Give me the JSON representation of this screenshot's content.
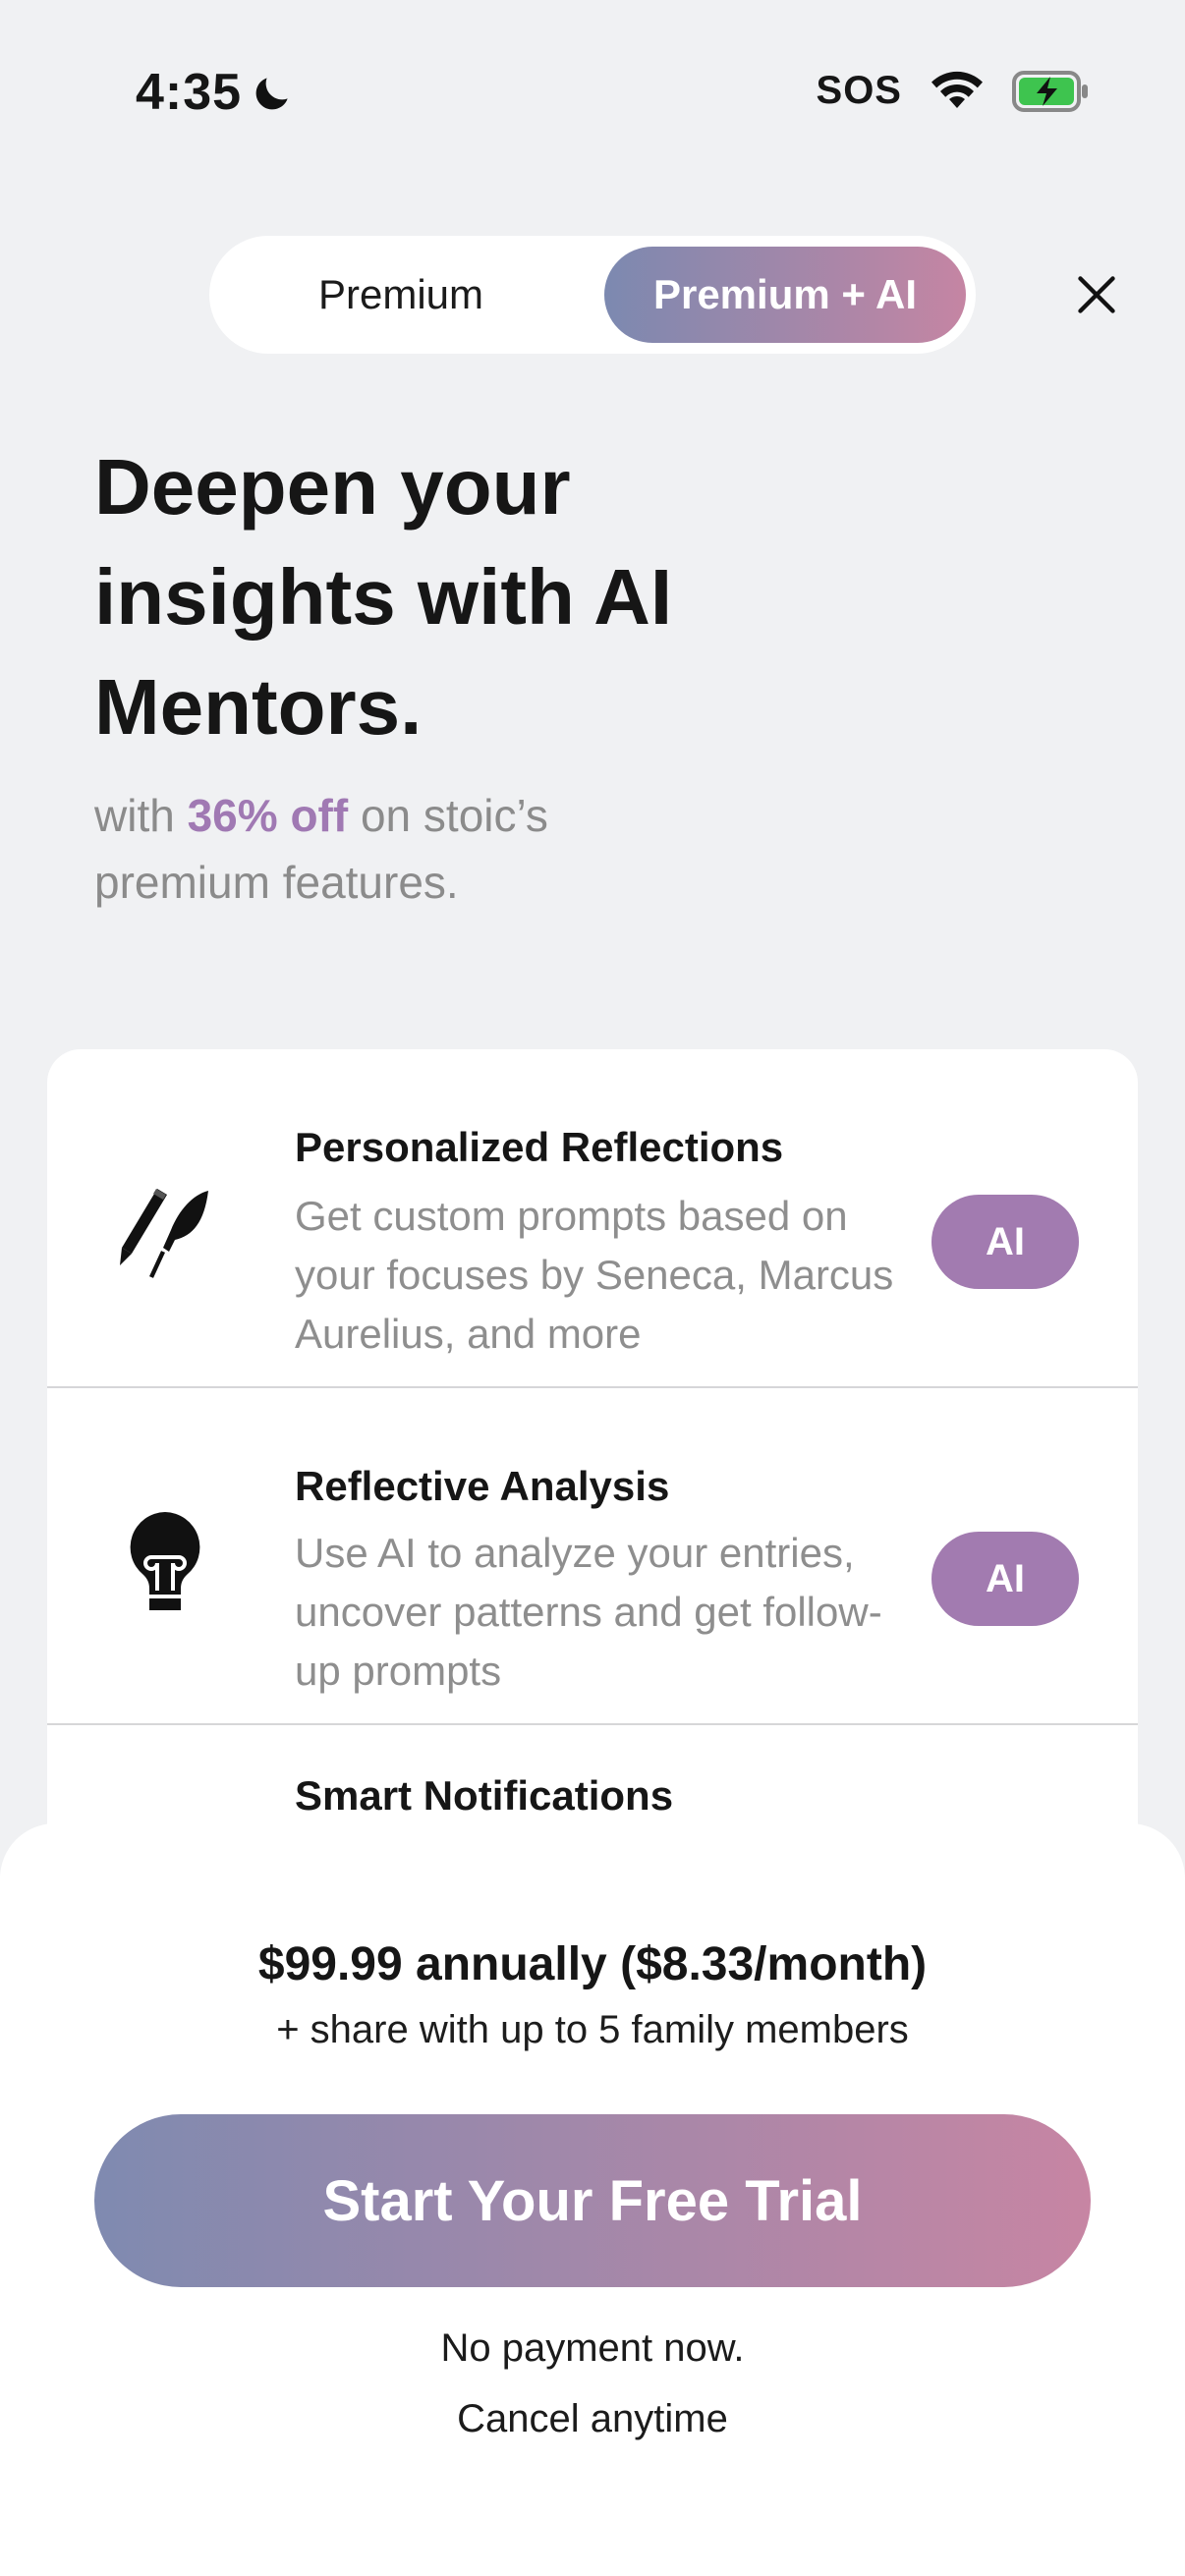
{
  "status_bar": {
    "time": "4:35",
    "carrier": "SOS"
  },
  "tabs": [
    {
      "label": "Premium",
      "selected": false
    },
    {
      "label": "Premium + AI",
      "selected": true
    }
  ],
  "headline": {
    "lines": [
      "Deepen your",
      "insights with AI",
      "Mentors."
    ]
  },
  "subheadline": {
    "prefix": "with ",
    "highlight": "36% off",
    "suffix": " on stoic’s",
    "line2": "premium features."
  },
  "features": [
    {
      "icon": "pen-quill-icon",
      "title": "Personalized Reflections",
      "description": "Get custom prompts based on your focuses by Seneca, Marcus Aurelius, and more",
      "badge": "AI"
    },
    {
      "icon": "lightbulb-icon",
      "title": "Reflective Analysis",
      "description": "Use AI to analyze your entries, uncover patterns and get follow-up prompts",
      "badge": "AI"
    },
    {
      "icon": "",
      "title": "Smart Notifications",
      "description": "",
      "badge": ""
    }
  ],
  "pricing": {
    "price_text": "$99.99 annually ($8.33/month)",
    "share_text": "+ share with up to 5 family members"
  },
  "cta": {
    "label": "Start Your Free Trial"
  },
  "notes": [
    "No payment now.",
    "Cancel anytime"
  ],
  "colors": {
    "accent": "#a079b3",
    "gradient_start": "#7f8ab0",
    "gradient_end": "#c785a3",
    "badge": "#a27bb0"
  }
}
